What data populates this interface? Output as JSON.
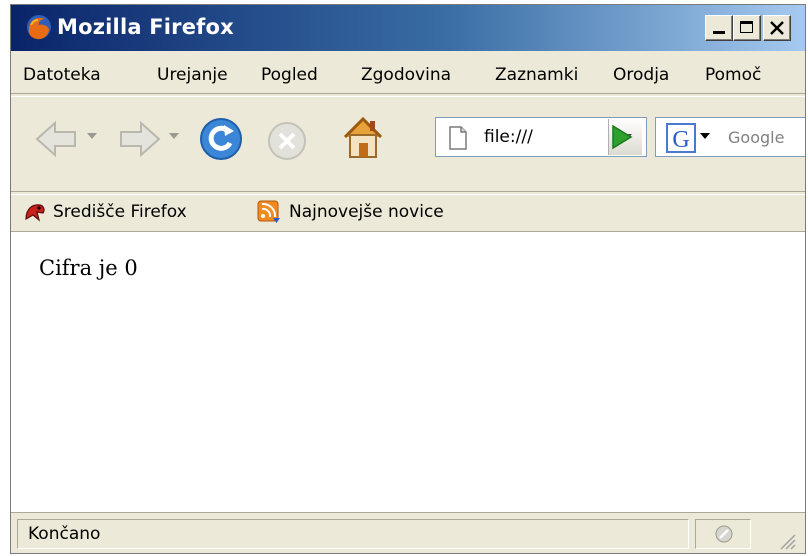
{
  "window": {
    "title": "Mozilla Firefox"
  },
  "menu": {
    "items": [
      "Datoteka",
      "Urejanje",
      "Pogled",
      "Zgodovina",
      "Zaznamki",
      "Orodja",
      "Pomoč"
    ]
  },
  "toolbar": {
    "url_value": "file:///",
    "search_placeholder": "Google",
    "icons": [
      "back-icon",
      "forward-icon",
      "reload-icon",
      "stop-icon",
      "home-icon",
      "page-icon",
      "go-icon",
      "google-icon"
    ]
  },
  "bookmarks": {
    "items": [
      {
        "label": "Središče Firefox",
        "icon": "firefox-hub-icon"
      },
      {
        "label": "Najnovejše novice",
        "icon": "rss-feed-icon"
      }
    ]
  },
  "content": {
    "text": "Cifra je 0"
  },
  "status": {
    "text": "Končano"
  },
  "colors": {
    "title_gradient_start": "#0a246a",
    "title_gradient_end": "#a6caf0",
    "chrome_bg": "#ece9d8",
    "go_green": "#2ea02e"
  }
}
